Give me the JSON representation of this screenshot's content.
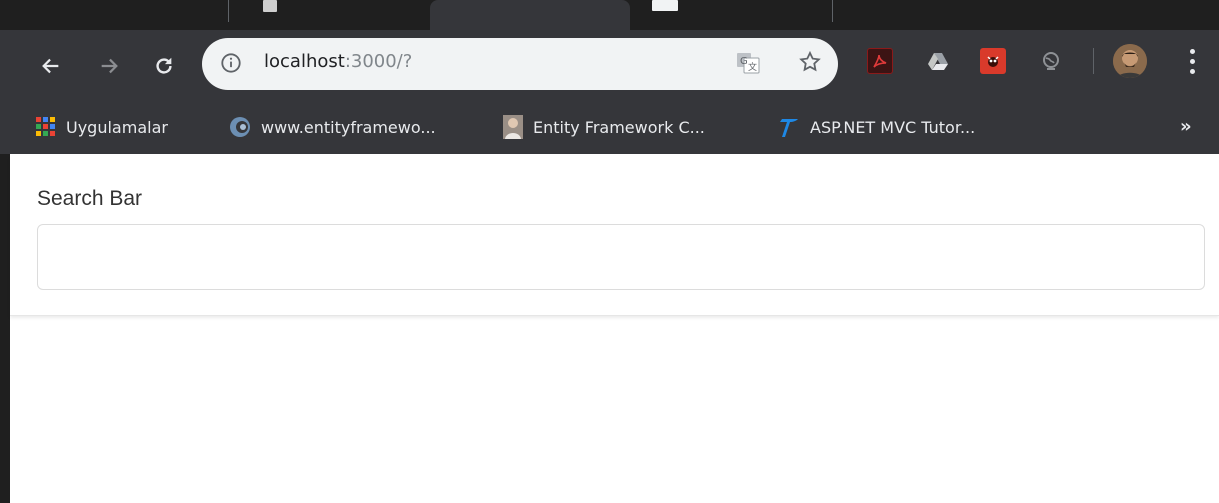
{
  "browser": {
    "address_bar": {
      "host": "localhost",
      "rest": ":3000/?"
    },
    "bookmarks": [
      {
        "label": "Uygulamalar",
        "icon": "apps-grid-icon"
      },
      {
        "label": "www.entityframewo...",
        "icon": "entityframework-icon"
      },
      {
        "label": "Entity Framework C...",
        "icon": "person-photo-icon"
      },
      {
        "label": "ASP.NET MVC Tutor...",
        "icon": "tutorialsteacher-icon"
      }
    ],
    "bookmarks_overflow": "»",
    "extensions": [
      "acrobat-icon",
      "drive-icon",
      "bug-extension-icon",
      "earth-extension-icon"
    ],
    "accent_dark": "#35363a"
  },
  "page": {
    "search_label": "Search Bar",
    "search_value": "",
    "search_placeholder": ""
  }
}
